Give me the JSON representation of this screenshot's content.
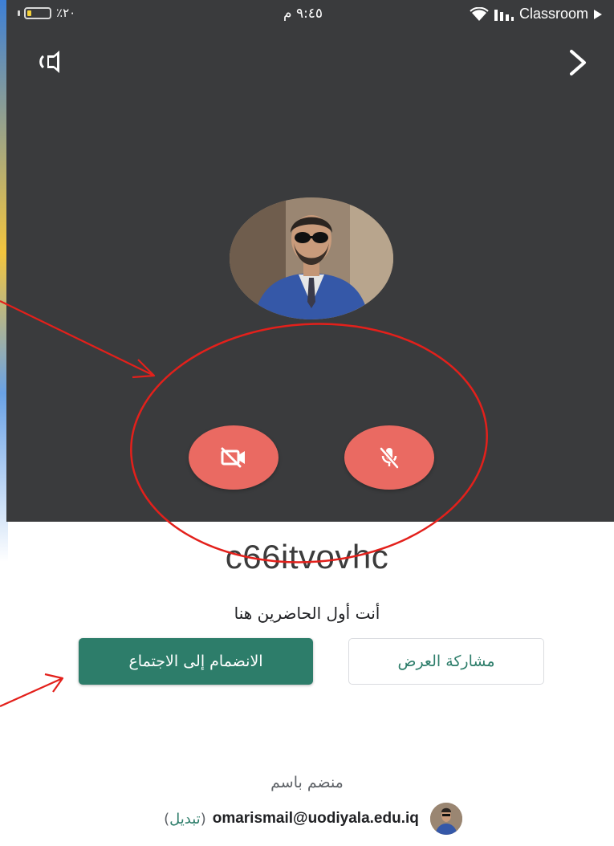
{
  "status_bar": {
    "battery_percent": "٪٢٠",
    "battery_level": 0.2,
    "time": "٩:٤٥ م",
    "back_app": "Classroom"
  },
  "icons": {
    "audio_output": "speaker-icon",
    "next": "chevron-right-icon",
    "camera": "camera-off-icon",
    "mic": "mic-off-icon"
  },
  "colors": {
    "video_background": "#3a3b3d",
    "off_button": "#ea6a62",
    "primary": "#2d7d6a",
    "annotation": "#e3201b"
  },
  "meeting": {
    "code": "c66itvovhc",
    "status": "أنت أول الحاضرين هنا"
  },
  "buttons": {
    "join": "الانضمام إلى الاجتماع",
    "present": "مشاركة العرض"
  },
  "account": {
    "joining_as": "منضم باسم",
    "email": "omarismail@uodiyala.edu.iq",
    "switch_open": "(",
    "switch": "تبديل",
    "switch_close": ")"
  }
}
